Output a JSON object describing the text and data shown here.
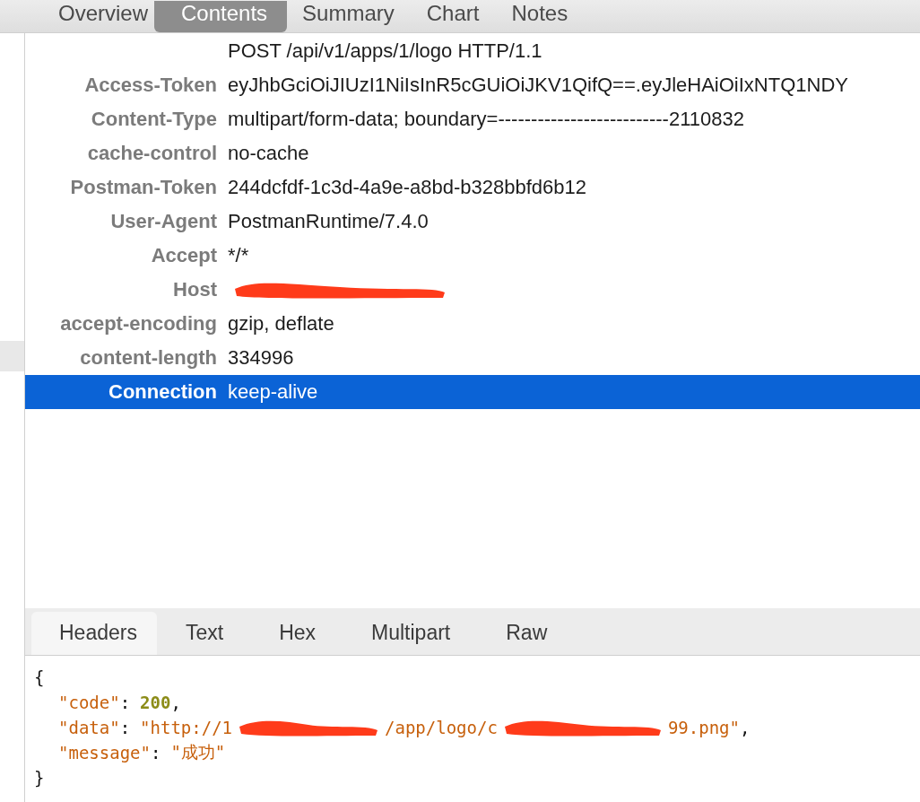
{
  "tabs": [
    {
      "label": "Overview",
      "selected": false
    },
    {
      "label": "Contents",
      "selected": true
    },
    {
      "label": "Summary",
      "selected": false
    },
    {
      "label": "Chart",
      "selected": false
    },
    {
      "label": "Notes",
      "selected": false
    }
  ],
  "request_line": "POST /api/v1/apps/1/logo HTTP/1.1",
  "headers": [
    {
      "name": "Access-Token",
      "value": "eyJhbGciOiJIUzI1NiIsInR5cGUiOiJKV1QifQ==.eyJleHAiOiIxNTQ1NDY",
      "selected": false,
      "redacted": false
    },
    {
      "name": "Content-Type",
      "value": "multipart/form-data; boundary=--------------------------2110832",
      "selected": false,
      "redacted": false
    },
    {
      "name": "cache-control",
      "value": "no-cache",
      "selected": false,
      "redacted": false
    },
    {
      "name": "Postman-Token",
      "value": "244dcfdf-1c3d-4a9e-a8bd-b328bbfd6b12",
      "selected": false,
      "redacted": false
    },
    {
      "name": "User-Agent",
      "value": "PostmanRuntime/7.4.0",
      "selected": false,
      "redacted": false
    },
    {
      "name": "Accept",
      "value": "*/*",
      "selected": false,
      "redacted": false
    },
    {
      "name": "Host",
      "selected": false,
      "redacted": true
    },
    {
      "name": "accept-encoding",
      "value": "gzip, deflate",
      "selected": false,
      "redacted": false
    },
    {
      "name": "content-length",
      "value": "334996",
      "selected": false,
      "redacted": false
    },
    {
      "name": "Connection",
      "value": "keep-alive",
      "selected": true,
      "redacted": false
    }
  ],
  "response_tabs": [
    {
      "label": "Headers",
      "selected": true
    },
    {
      "label": "Text",
      "selected": false
    },
    {
      "label": "Hex",
      "selected": false
    },
    {
      "label": "Multipart",
      "selected": false
    },
    {
      "label": "Raw",
      "selected": false
    }
  ],
  "body": {
    "open_brace": "{",
    "fields": [
      {
        "key": "\"code\"",
        "colon": ":",
        "kind": "number",
        "value_parts": [
          "200"
        ],
        "comma": ","
      },
      {
        "key": "\"data\"",
        "colon": ":",
        "kind": "string",
        "value_parts": [
          "\"http://1",
          "/app/logo/c",
          "99.png\""
        ],
        "comma": ","
      },
      {
        "key": "\"message\"",
        "colon": ":",
        "kind": "string",
        "value_parts": [
          "\"成功\""
        ]
      }
    ],
    "close_brace": "}"
  }
}
